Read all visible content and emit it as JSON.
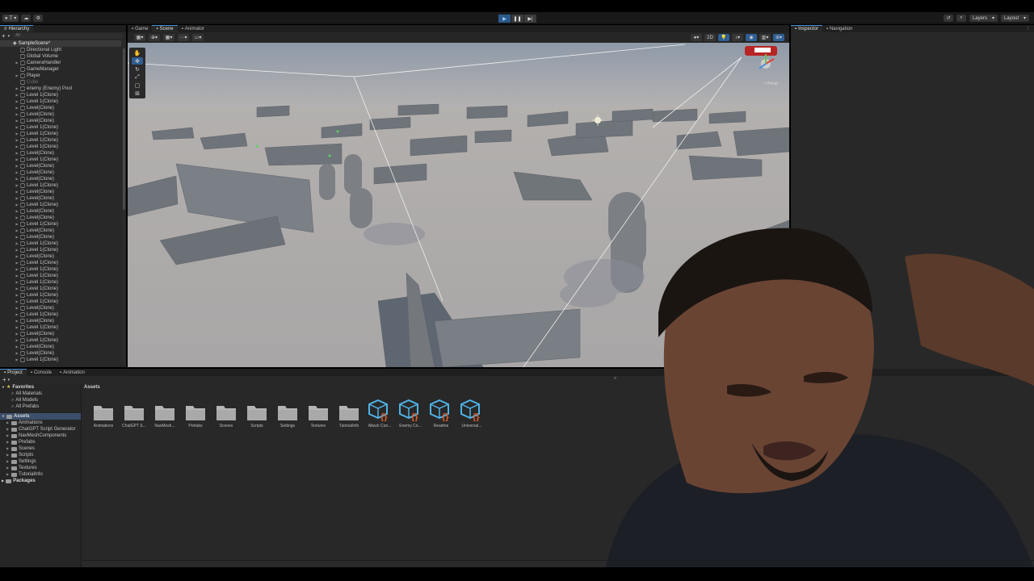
{
  "topbar": {
    "account_label": "T",
    "play_buttons": [
      "▶",
      "❚❚",
      "▶|"
    ],
    "layers_label": "Layers",
    "layout_label": "Layout"
  },
  "hierarchy": {
    "tab_label": "Hierarchy",
    "search_placeholder": "All",
    "scene_name": "SampleScene*",
    "items": [
      {
        "label": "Directional Light",
        "depth": 1,
        "expandable": false,
        "dim": false
      },
      {
        "label": "Global Volume",
        "depth": 1,
        "expandable": false,
        "dim": false
      },
      {
        "label": "CameraHandler",
        "depth": 1,
        "expandable": true,
        "dim": false
      },
      {
        "label": "GameManager",
        "depth": 1,
        "expandable": false,
        "dim": false
      },
      {
        "label": "Player",
        "depth": 1,
        "expandable": true,
        "dim": false
      },
      {
        "label": "Cube",
        "depth": 1,
        "expandable": false,
        "dim": true
      },
      {
        "label": "enemy (Enemy) Pool",
        "depth": 1,
        "expandable": true,
        "dim": false
      },
      {
        "label": "Level 1(Clone)",
        "depth": 1,
        "expandable": true,
        "dim": false
      },
      {
        "label": "Level 1(Clone)",
        "depth": 1,
        "expandable": true,
        "dim": false
      },
      {
        "label": "Level(Clone)",
        "depth": 1,
        "expandable": true,
        "dim": false
      },
      {
        "label": "Level(Clone)",
        "depth": 1,
        "expandable": true,
        "dim": false
      },
      {
        "label": "Level(Clone)",
        "depth": 1,
        "expandable": true,
        "dim": false
      },
      {
        "label": "Level 1(Clone)",
        "depth": 1,
        "expandable": true,
        "dim": false
      },
      {
        "label": "Level 1(Clone)",
        "depth": 1,
        "expandable": true,
        "dim": false
      },
      {
        "label": "Level 1(Clone)",
        "depth": 1,
        "expandable": true,
        "dim": false
      },
      {
        "label": "Level 1(Clone)",
        "depth": 1,
        "expandable": true,
        "dim": false
      },
      {
        "label": "Level(Clone)",
        "depth": 1,
        "expandable": true,
        "dim": false
      },
      {
        "label": "Level 1(Clone)",
        "depth": 1,
        "expandable": true,
        "dim": false
      },
      {
        "label": "Level(Clone)",
        "depth": 1,
        "expandable": true,
        "dim": false
      },
      {
        "label": "Level(Clone)",
        "depth": 1,
        "expandable": true,
        "dim": false
      },
      {
        "label": "Level(Clone)",
        "depth": 1,
        "expandable": true,
        "dim": false
      },
      {
        "label": "Level 1(Clone)",
        "depth": 1,
        "expandable": true,
        "dim": false
      },
      {
        "label": "Level(Clone)",
        "depth": 1,
        "expandable": true,
        "dim": false
      },
      {
        "label": "Level(Clone)",
        "depth": 1,
        "expandable": true,
        "dim": false
      },
      {
        "label": "Level 1(Clone)",
        "depth": 1,
        "expandable": true,
        "dim": false
      },
      {
        "label": "Level(Clone)",
        "depth": 1,
        "expandable": true,
        "dim": false
      },
      {
        "label": "Level(Clone)",
        "depth": 1,
        "expandable": true,
        "dim": false
      },
      {
        "label": "Level 1(Clone)",
        "depth": 1,
        "expandable": true,
        "dim": false
      },
      {
        "label": "Level(Clone)",
        "depth": 1,
        "expandable": true,
        "dim": false
      },
      {
        "label": "Level(Clone)",
        "depth": 1,
        "expandable": true,
        "dim": false
      },
      {
        "label": "Level 1(Clone)",
        "depth": 1,
        "expandable": true,
        "dim": false
      },
      {
        "label": "Level 1(Clone)",
        "depth": 1,
        "expandable": true,
        "dim": false
      },
      {
        "label": "Level(Clone)",
        "depth": 1,
        "expandable": true,
        "dim": false
      },
      {
        "label": "Level 1(Clone)",
        "depth": 1,
        "expandable": true,
        "dim": false
      },
      {
        "label": "Level 1(Clone)",
        "depth": 1,
        "expandable": true,
        "dim": false
      },
      {
        "label": "Level 1(Clone)",
        "depth": 1,
        "expandable": true,
        "dim": false
      },
      {
        "label": "Level 1(Clone)",
        "depth": 1,
        "expandable": true,
        "dim": false
      },
      {
        "label": "Level 1(Clone)",
        "depth": 1,
        "expandable": true,
        "dim": false
      },
      {
        "label": "Level 1(Clone)",
        "depth": 1,
        "expandable": true,
        "dim": false
      },
      {
        "label": "Level 1(Clone)",
        "depth": 1,
        "expandable": true,
        "dim": false
      },
      {
        "label": "Level(Clone)",
        "depth": 1,
        "expandable": true,
        "dim": false
      },
      {
        "label": "Level 1(Clone)",
        "depth": 1,
        "expandable": true,
        "dim": false
      },
      {
        "label": "Level(Clone)",
        "depth": 1,
        "expandable": true,
        "dim": false
      },
      {
        "label": "Level 1(Clone)",
        "depth": 1,
        "expandable": true,
        "dim": false
      },
      {
        "label": "Level(Clone)",
        "depth": 1,
        "expandable": true,
        "dim": false
      },
      {
        "label": "Level 1(Clone)",
        "depth": 1,
        "expandable": true,
        "dim": false
      },
      {
        "label": "Level(Clone)",
        "depth": 1,
        "expandable": true,
        "dim": false
      },
      {
        "label": "Level(Clone)",
        "depth": 1,
        "expandable": true,
        "dim": false
      },
      {
        "label": "Level 1(Clone)",
        "depth": 1,
        "expandable": true,
        "dim": false
      }
    ]
  },
  "scene": {
    "tabs": [
      {
        "label": "Game",
        "active": false
      },
      {
        "label": "Scene",
        "active": true
      },
      {
        "label": "Animator",
        "active": false
      }
    ],
    "mode_2d": "2D",
    "gizmo_persp_label": "< Persp"
  },
  "inspector": {
    "tabs": [
      {
        "label": "Inspector",
        "active": true
      },
      {
        "label": "Navigation",
        "active": false
      }
    ]
  },
  "project": {
    "tabs": [
      {
        "label": "Project",
        "active": true
      },
      {
        "label": "Console",
        "active": false
      },
      {
        "label": "Animation",
        "active": false
      }
    ],
    "favorites_label": "Favorites",
    "favorites": [
      "All Materials",
      "All Models",
      "All Prefabs"
    ],
    "assets_label": "Assets",
    "asset_folders_tree": [
      "Animations",
      "ChatGPT Script Generator",
      "NavMeshComponents",
      "Prefabs",
      "Scenes",
      "Scripts",
      "Settings",
      "Textures",
      "TutorialInfo"
    ],
    "packages_label": "Packages",
    "breadcrumb": "Assets",
    "grid": [
      {
        "label": "Animations",
        "kind": "folder"
      },
      {
        "label": "ChatGPT S...",
        "kind": "folder"
      },
      {
        "label": "NavMesh...",
        "kind": "folder"
      },
      {
        "label": "Prefabs",
        "kind": "folder"
      },
      {
        "label": "Scenes",
        "kind": "folder"
      },
      {
        "label": "Scripts",
        "kind": "folder"
      },
      {
        "label": "Settings",
        "kind": "folder"
      },
      {
        "label": "Textures",
        "kind": "folder"
      },
      {
        "label": "TutorialInfo",
        "kind": "folder"
      },
      {
        "label": "Attack Con...",
        "kind": "script-asset"
      },
      {
        "label": "Enemy Co...",
        "kind": "script-asset"
      },
      {
        "label": "Readme",
        "kind": "script-asset"
      },
      {
        "label": "Universal...",
        "kind": "script-asset"
      }
    ]
  },
  "colors": {
    "accent": "#4a8fd8",
    "panel": "#282828",
    "sky": "#9aa3b0",
    "ground": "#b9b6b5",
    "asset_icon": "#4fb3e8",
    "asset_icon_brace": "#e0602a"
  }
}
